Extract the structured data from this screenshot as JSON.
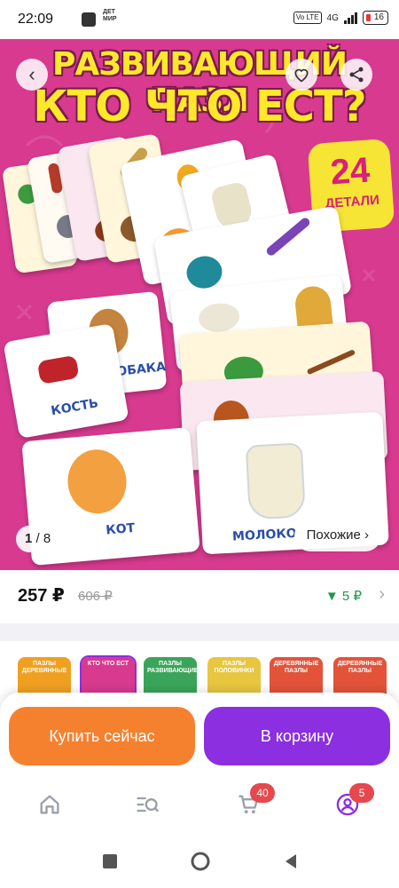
{
  "status_bar": {
    "time": "22:09",
    "brand_text": "ДЕТ МИР",
    "network": "4G",
    "volte": "Vo LTE",
    "battery": "16"
  },
  "hero": {
    "title_line1": "РАЗВИВАЮЩИЙ ПАЗЛ",
    "title_line2": "КТО ЧТО ЕСТ?",
    "badge_number": "24",
    "badge_text": "ДЕТАЛИ",
    "word_bone": "КОСТЬ",
    "word_dog": "СОБАКА",
    "word_cat": "КОТ",
    "word_milk": "МОЛОКО",
    "counter_current": "1",
    "counter_total": "/ 8",
    "similar_label": "Похожие ›",
    "back_icon": "chevron-left-icon",
    "favorite_icon": "heart-icon",
    "share_icon": "share-icon"
  },
  "price": {
    "current": "257 ₽",
    "old": "606 ₽",
    "delta": "▼ 5 ₽",
    "chevron": "›"
  },
  "thumbnails": [
    {
      "title": "ПАЗЛЫ ДЕРЕВЯННЫЕ",
      "color": "#f0a020"
    },
    {
      "title": "КТО ЧТО ЕСТ",
      "color": "#d83a8f"
    },
    {
      "title": "ПАЗЛЫ РАЗВИВАЮЩИЕ",
      "color": "#3aa55a"
    },
    {
      "title": "ПАЗЛЫ ПОЛОВИНКИ",
      "color": "#e8c640"
    },
    {
      "title": "ДЕРЕВЯННЫЕ ПАЗЛЫ",
      "color": "#e2533a"
    },
    {
      "title": "ДЕРЕВЯННЫЕ ПАЗЛЫ",
      "color": "#e2533a"
    }
  ],
  "actions": {
    "buy_now": "Купить сейчас",
    "add_to_cart": "В корзину"
  },
  "tabbar": {
    "cart_count": "40",
    "profile_count": "5"
  },
  "colors": {
    "accent_purple": "#8b2fe0",
    "accent_orange": "#f5812f",
    "hero_pink": "#d83a8f"
  }
}
